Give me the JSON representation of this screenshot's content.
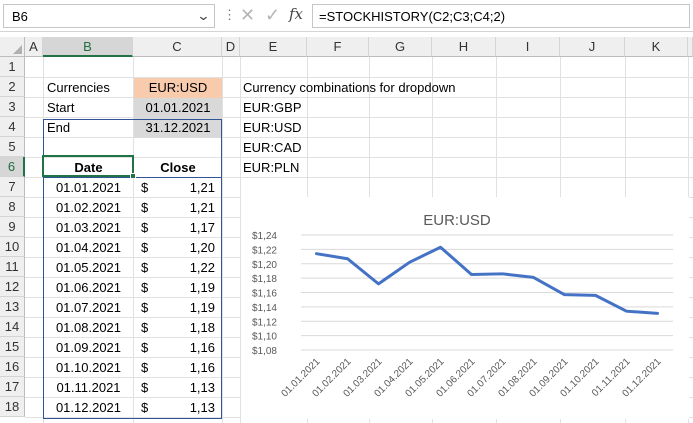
{
  "formula_bar": {
    "name_box": "B6",
    "chevron_icon": "chevron-down-icon",
    "dots": "⋮",
    "cancel_icon": "✕",
    "enter_icon": "✓",
    "fx": "fx",
    "formula": "=STOCKHISTORY(C2;C3;C4;2)"
  },
  "grid": {
    "columns": [
      "A",
      "B",
      "C",
      "D",
      "E",
      "F",
      "G",
      "H",
      "I",
      "J",
      "K"
    ],
    "rows": [
      "1",
      "2",
      "3",
      "4",
      "5",
      "6",
      "7",
      "8",
      "9",
      "10",
      "11",
      "12",
      "13",
      "14",
      "15",
      "16",
      "17",
      "18"
    ],
    "selected_column": "B",
    "selected_row": "6"
  },
  "params": {
    "currencies_label": "Currencies",
    "currencies_value": "EUR:USD",
    "start_label": "Start",
    "start_value": "01.01.2021",
    "end_label": "End",
    "end_value": "31.12.2021"
  },
  "dropdown_list": {
    "title": "Currency combinations for dropdown",
    "items": [
      "EUR:GBP",
      "EUR:USD",
      "EUR:CAD",
      "EUR:PLN"
    ]
  },
  "table": {
    "headers": [
      "Date",
      "Close"
    ],
    "currency_symbol": "$",
    "rows": [
      {
        "date": "01.01.2021",
        "close": "1,21"
      },
      {
        "date": "01.02.2021",
        "close": "1,21"
      },
      {
        "date": "01.03.2021",
        "close": "1,17"
      },
      {
        "date": "01.04.2021",
        "close": "1,20"
      },
      {
        "date": "01.05.2021",
        "close": "1,22"
      },
      {
        "date": "01.06.2021",
        "close": "1,19"
      },
      {
        "date": "01.07.2021",
        "close": "1,19"
      },
      {
        "date": "01.08.2021",
        "close": "1,18"
      },
      {
        "date": "01.09.2021",
        "close": "1,16"
      },
      {
        "date": "01.10.2021",
        "close": "1,16"
      },
      {
        "date": "01.11.2021",
        "close": "1,13"
      },
      {
        "date": "01.12.2021",
        "close": "1,13"
      }
    ]
  },
  "colors": {
    "accent": "#217346",
    "series": "#4472c4",
    "orange_fill": "#f8cbad",
    "gray_fill": "#d9d9d9",
    "table_border": "#2f5597"
  },
  "chart_data": {
    "type": "line",
    "title": "EUR:USD",
    "categories": [
      "01.01.2021",
      "01.02.2021",
      "01.03.2021",
      "01.04.2021",
      "01.05.2021",
      "01.06.2021",
      "01.07.2021",
      "01.08.2021",
      "01.09.2021",
      "01.10.2021",
      "01.11.2021",
      "01.12.2021"
    ],
    "values": [
      1.214,
      1.207,
      1.172,
      1.202,
      1.223,
      1.185,
      1.186,
      1.181,
      1.157,
      1.156,
      1.134,
      1.131
    ],
    "y_ticks": [
      "$1,08",
      "$1,10",
      "$1,12",
      "$1,14",
      "$1,16",
      "$1,18",
      "$1,20",
      "$1,22",
      "$1,24"
    ],
    "ylim": [
      1.08,
      1.24
    ],
    "grid": true,
    "legend": "none"
  }
}
